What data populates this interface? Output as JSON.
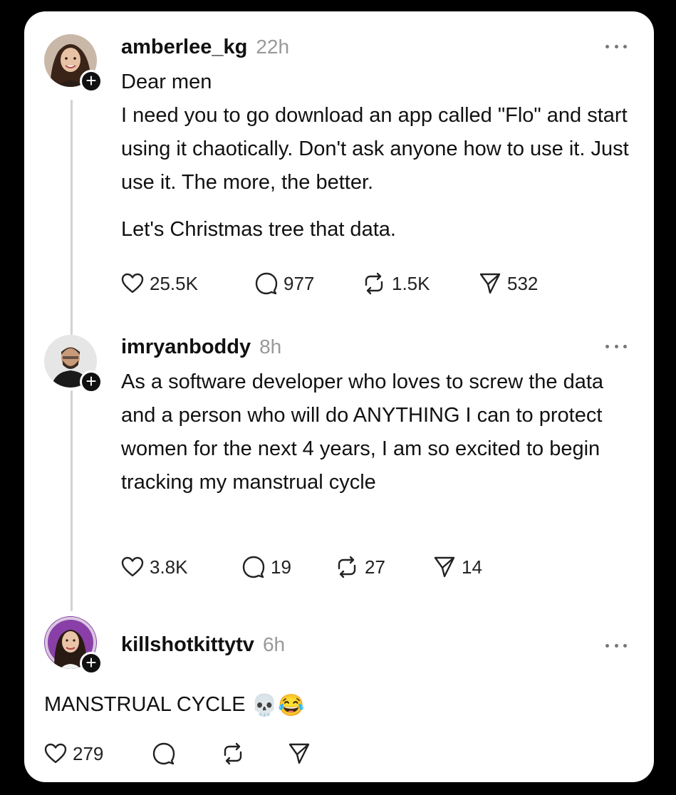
{
  "posts": [
    {
      "username": "amberlee_kg",
      "time": "22h",
      "greeting": "Dear men",
      "body": "I need you to go download an app called \"Flo\" and start using it chaotically. Don't ask anyone how to use it. Just use it. The more, the better.",
      "closing": "Let's Christmas tree that data.",
      "likes": "25.5K",
      "replies": "977",
      "reposts": "1.5K",
      "shares": "532"
    },
    {
      "username": "imryanboddy",
      "time": "8h",
      "body": "As a software developer who loves to screw the data and a person who will do ANYTHING I can to protect women for the next 4 years, I am so excited to begin tracking my manstrual cycle",
      "likes": "3.8K",
      "replies": "19",
      "reposts": "27",
      "shares": "14"
    },
    {
      "username": "killshotkittytv",
      "time": "6h",
      "body": "MANSTRUAL CYCLE",
      "emojis": "💀😂",
      "likes": "279"
    }
  ],
  "icons": {
    "like": "heart-icon",
    "reply": "comment-icon",
    "repost": "repost-icon",
    "share": "send-icon",
    "more": "more-icon",
    "follow": "plus-icon"
  },
  "colors": {
    "text": "#111111",
    "muted": "#999999",
    "thread_line": "#d2d2d2"
  }
}
